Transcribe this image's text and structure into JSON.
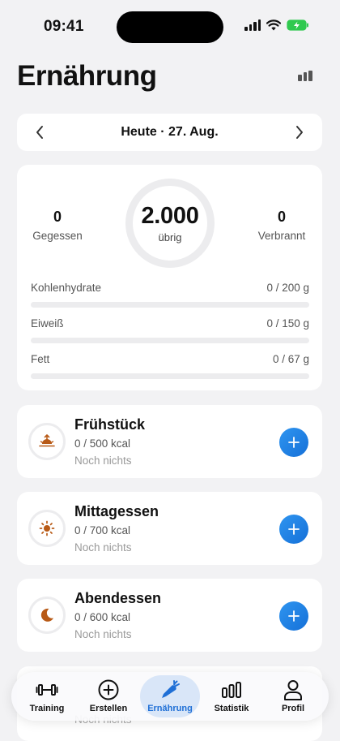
{
  "status_bar": {
    "time": "09:41"
  },
  "header": {
    "title": "Ernährung"
  },
  "date_nav": {
    "label": "Heute · 27. Aug."
  },
  "summary": {
    "eaten": {
      "value": "0",
      "label": "Gegessen"
    },
    "remaining": {
      "value": "2.000",
      "label": "übrig"
    },
    "burned": {
      "value": "0",
      "label": "Verbrannt"
    },
    "macros": [
      {
        "name": "Kohlenhydrate",
        "value": "0 / 200 g",
        "progress": 0
      },
      {
        "name": "Eiweiß",
        "value": "0 / 150 g",
        "progress": 0
      },
      {
        "name": "Fett",
        "value": "0 / 67 g",
        "progress": 0
      }
    ]
  },
  "meals": [
    {
      "title": "Frühstück",
      "kcal": "0 / 500 kcal",
      "status": "Noch nichts",
      "icon": "sunrise-icon"
    },
    {
      "title": "Mittagessen",
      "kcal": "0 / 700 kcal",
      "status": "Noch nichts",
      "icon": "sun-icon"
    },
    {
      "title": "Abendessen",
      "kcal": "0 / 600 kcal",
      "status": "Noch nichts",
      "icon": "moon-icon"
    }
  ],
  "peek_meal": {
    "status": "Noch nichts"
  },
  "tabs": [
    {
      "label": "Training",
      "icon": "dumbbell-icon",
      "active": false
    },
    {
      "label": "Erstellen",
      "icon": "plus-circle-icon",
      "active": false
    },
    {
      "label": "Ernährung",
      "icon": "carrot-icon",
      "active": true
    },
    {
      "label": "Statistik",
      "icon": "bar-chart-icon",
      "active": false
    },
    {
      "label": "Profil",
      "icon": "person-icon",
      "active": false
    }
  ],
  "colors": {
    "accent": "#1f6fd6",
    "meal_icon": "#b85a16",
    "battery": "#30c94f"
  }
}
